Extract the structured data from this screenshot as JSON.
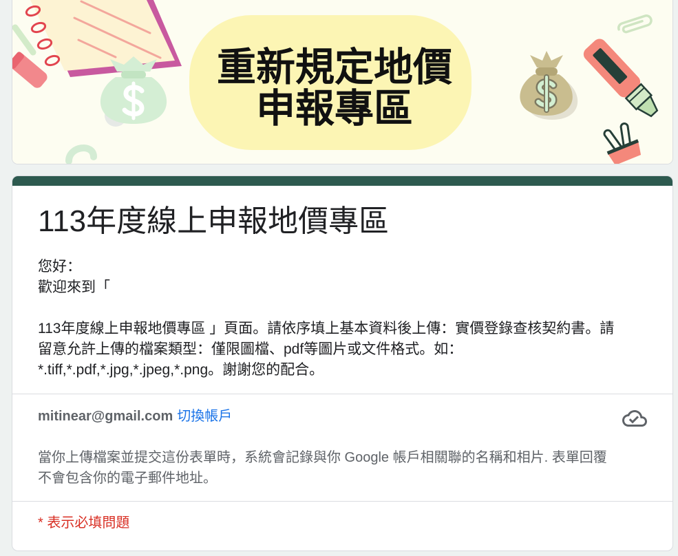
{
  "banner": {
    "title_line1": "重新規定地價",
    "title_line2": "申報專區",
    "decorations": [
      "notebook-icon",
      "eraser-icon",
      "pencil-icon",
      "money-bag-icon",
      "question-mark-icon",
      "highlighter-icon",
      "paperclip-icon",
      "binder-clip-icon"
    ]
  },
  "form": {
    "title": "113年度線上申報地價專區",
    "description_lines": [
      "您好：",
      "歡迎來到「",
      "",
      "113年度線上申報地價專區 」頁面。請依序填上基本資料後上傳：實價登錄查核契約書。請",
      "留意允許上傳的檔案類型：僅限圖檔、pdf等圖片或文件格式。如：",
      "*.tiff,*.pdf,*.jpg,*.jpeg,*.png。謝謝您的配合。"
    ]
  },
  "account": {
    "email": "mitinear@gmail.com",
    "switch_account_label": "切換帳戶",
    "status_icon": "cloud-done-icon",
    "notice_lines": [
      "當你上傳檔案並提交這份表單時，系統會記錄與你 Google 帳戶相關聯的名稱和相片. 表單回覆",
      "不會包含你的電子郵件地址。"
    ]
  },
  "required_notice": "* 表示必填問題",
  "theme": {
    "accent": "#2d5a4f",
    "page_background": "#eef2f1",
    "banner_background": "#fdfdf1",
    "banner_pill": "#fcf5b4",
    "link": "#1a73e8",
    "required": "#d93025",
    "secondary_text": "#5f6368"
  }
}
